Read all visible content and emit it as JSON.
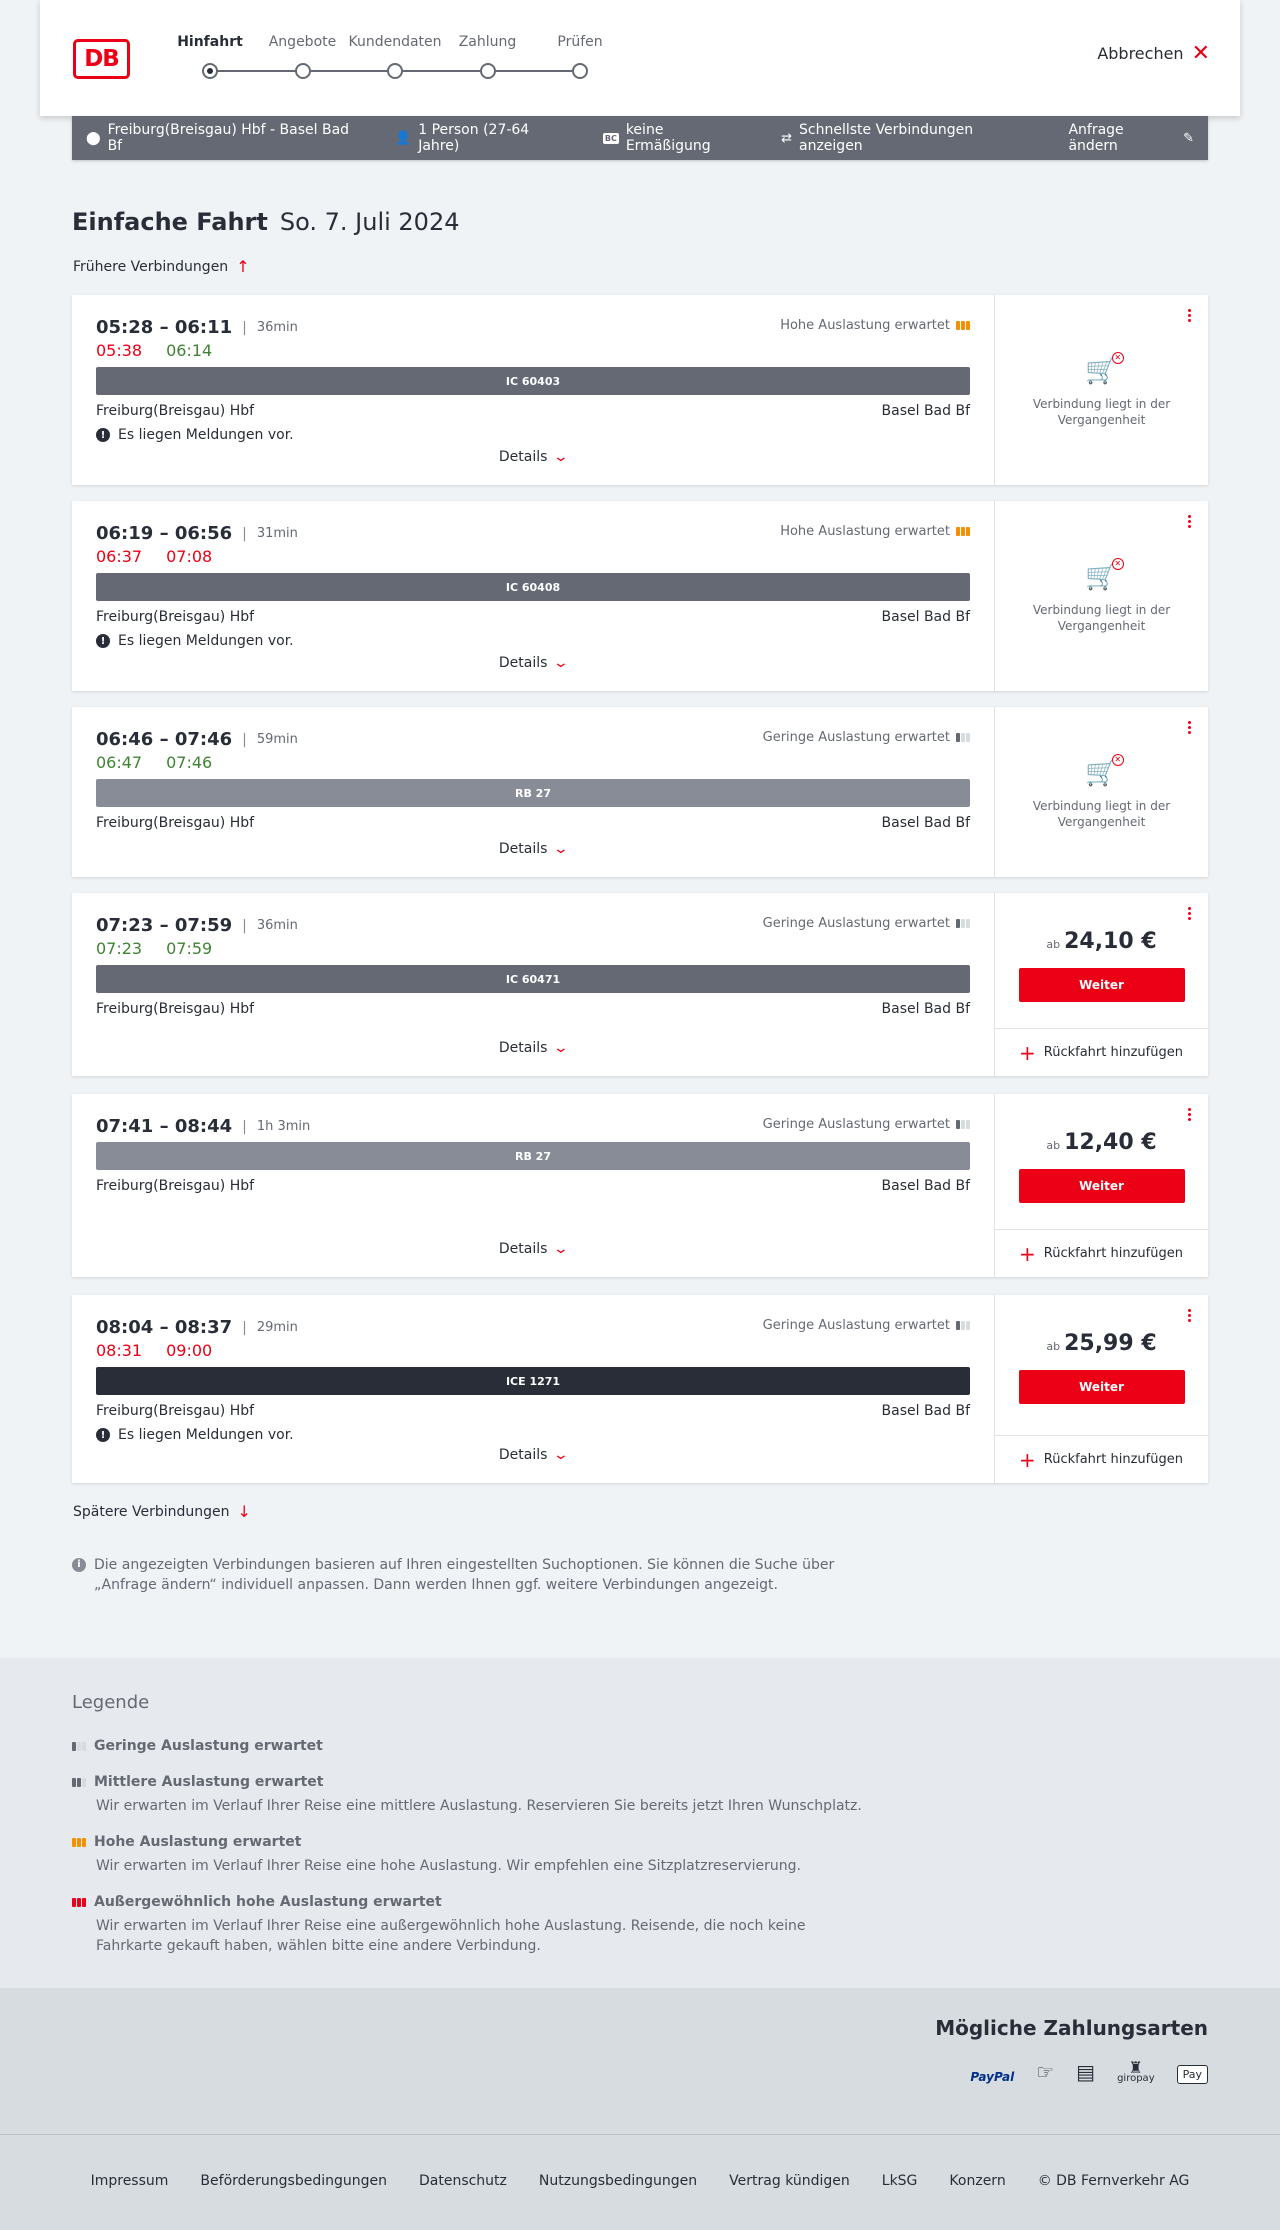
{
  "header": {
    "logo": "DB",
    "steps": [
      "Hinfahrt",
      "Angebote",
      "Kundendaten",
      "Zahlung",
      "Prüfen"
    ],
    "active_step": 0,
    "cancel_label": "Abbrechen"
  },
  "searchbar": {
    "route": "Freiburg(Breisgau) Hbf - Basel Bad Bf",
    "travellers": "1 Person (27-64 Jahre)",
    "discount_badge": "BC",
    "discount": "keine Ermäßigung",
    "fastest": "Schnellste Verbindungen anzeigen",
    "change": "Anfrage ändern"
  },
  "title": {
    "main": "Einfache Fahrt",
    "date": "So. 7. Juli 2024"
  },
  "earlier_label": "Frühere Verbindungen",
  "later_label": "Spätere Verbindungen",
  "details_label": "Details",
  "notice_label": "Es liegen Meldungen vor.",
  "past_label": "Verbindung liegt in der Vergangenheit",
  "weiter_label": "Weiter",
  "return_label": "Rückfahrt hinzufügen",
  "price_prefix": "ab",
  "connections": [
    {
      "times": "05:28 – 06:11",
      "duration": "36min",
      "rt_dep": "05:38",
      "rt_arr": "06:14",
      "rt_dep_color": "red",
      "rt_arr_color": "green",
      "occupancy": "Hohe Auslastung erwartet",
      "occ_level": "high",
      "train": "IC 60403",
      "train_type": "ic",
      "from": "Freiburg(Breisgau) Hbf",
      "to": "Basel Bad Bf",
      "has_notice": true,
      "past": true,
      "price": ""
    },
    {
      "times": "06:19 – 06:56",
      "duration": "31min",
      "rt_dep": "06:37",
      "rt_arr": "07:08",
      "rt_dep_color": "red",
      "rt_arr_color": "red",
      "occupancy": "Hohe Auslastung erwartet",
      "occ_level": "high",
      "train": "IC 60408",
      "train_type": "ic",
      "from": "Freiburg(Breisgau) Hbf",
      "to": "Basel Bad Bf",
      "has_notice": true,
      "past": true,
      "price": ""
    },
    {
      "times": "06:46 – 07:46",
      "duration": "59min",
      "rt_dep": "06:47",
      "rt_arr": "07:46",
      "rt_dep_color": "green",
      "rt_arr_color": "green",
      "occupancy": "Geringe Auslastung erwartet",
      "occ_level": "low",
      "train": "RB 27",
      "train_type": "rb",
      "from": "Freiburg(Breisgau) Hbf",
      "to": "Basel Bad Bf",
      "has_notice": false,
      "past": true,
      "price": ""
    },
    {
      "times": "07:23 – 07:59",
      "duration": "36min",
      "rt_dep": "07:23",
      "rt_arr": "07:59",
      "rt_dep_color": "green",
      "rt_arr_color": "green",
      "occupancy": "Geringe Auslastung erwartet",
      "occ_level": "low",
      "train": "IC 60471",
      "train_type": "ic",
      "from": "Freiburg(Breisgau) Hbf",
      "to": "Basel Bad Bf",
      "has_notice": false,
      "past": false,
      "price": "24,10 €"
    },
    {
      "times": "07:41 – 08:44",
      "duration": "1h 3min",
      "rt_dep": "",
      "rt_arr": "",
      "rt_dep_color": "green",
      "rt_arr_color": "green",
      "occupancy": "Geringe Auslastung erwartet",
      "occ_level": "low",
      "train": "RB 27",
      "train_type": "rb",
      "from": "Freiburg(Breisgau) Hbf",
      "to": "Basel Bad Bf",
      "has_notice": false,
      "past": false,
      "price": "12,40 €"
    },
    {
      "times": "08:04 – 08:37",
      "duration": "29min",
      "rt_dep": "08:31",
      "rt_arr": "09:00",
      "rt_dep_color": "red",
      "rt_arr_color": "red",
      "occupancy": "Geringe Auslastung erwartet",
      "occ_level": "low",
      "train": "ICE 1271",
      "train_type": "ice",
      "from": "Freiburg(Breisgau) Hbf",
      "to": "Basel Bad Bf",
      "has_notice": true,
      "past": false,
      "price": "25,99 €"
    }
  ],
  "info_note": "Die angezeigten Verbindungen basieren auf Ihren eingestellten Suchoptionen. Sie können die Suche über „Anfrage ändern“ individuell anpassen. Dann werden Ihnen ggf. weitere Verbindungen angezeigt.",
  "legend": {
    "title": "Legende",
    "items": [
      {
        "label": "Geringe Auslastung erwartet",
        "desc": "",
        "level": "low"
      },
      {
        "label": "Mittlere Auslastung erwartet",
        "desc": "Wir erwarten im Verlauf Ihrer Reise eine mittlere Auslastung. Reservieren Sie bereits jetzt Ihren Wunschplatz.",
        "level": "mid"
      },
      {
        "label": "Hohe Auslastung erwartet",
        "desc": "Wir erwarten im Verlauf Ihrer Reise eine hohe Auslastung. Wir empfehlen eine Sitzplatzreservierung.",
        "level": "high"
      },
      {
        "label": "Außergewöhnlich hohe Auslastung erwartet",
        "desc": "Wir erwarten im Verlauf Ihrer Reise eine außergewöhnlich hohe Auslastung. Reisende, die noch keine Fahrkarte gekauft haben, wählen bitte eine andere Verbindung.",
        "level": "vhigh"
      }
    ]
  },
  "payment": {
    "title": "Mögliche Zahlungsarten",
    "methods": [
      "PayPal",
      "giropay",
      "Pay"
    ]
  },
  "footer": {
    "links": [
      "Impressum",
      "Beförderungsbedingungen",
      "Datenschutz",
      "Nutzungsbedingungen",
      "Vertrag kündigen",
      "LkSG",
      "Konzern",
      "© DB Fernverkehr AG"
    ]
  }
}
